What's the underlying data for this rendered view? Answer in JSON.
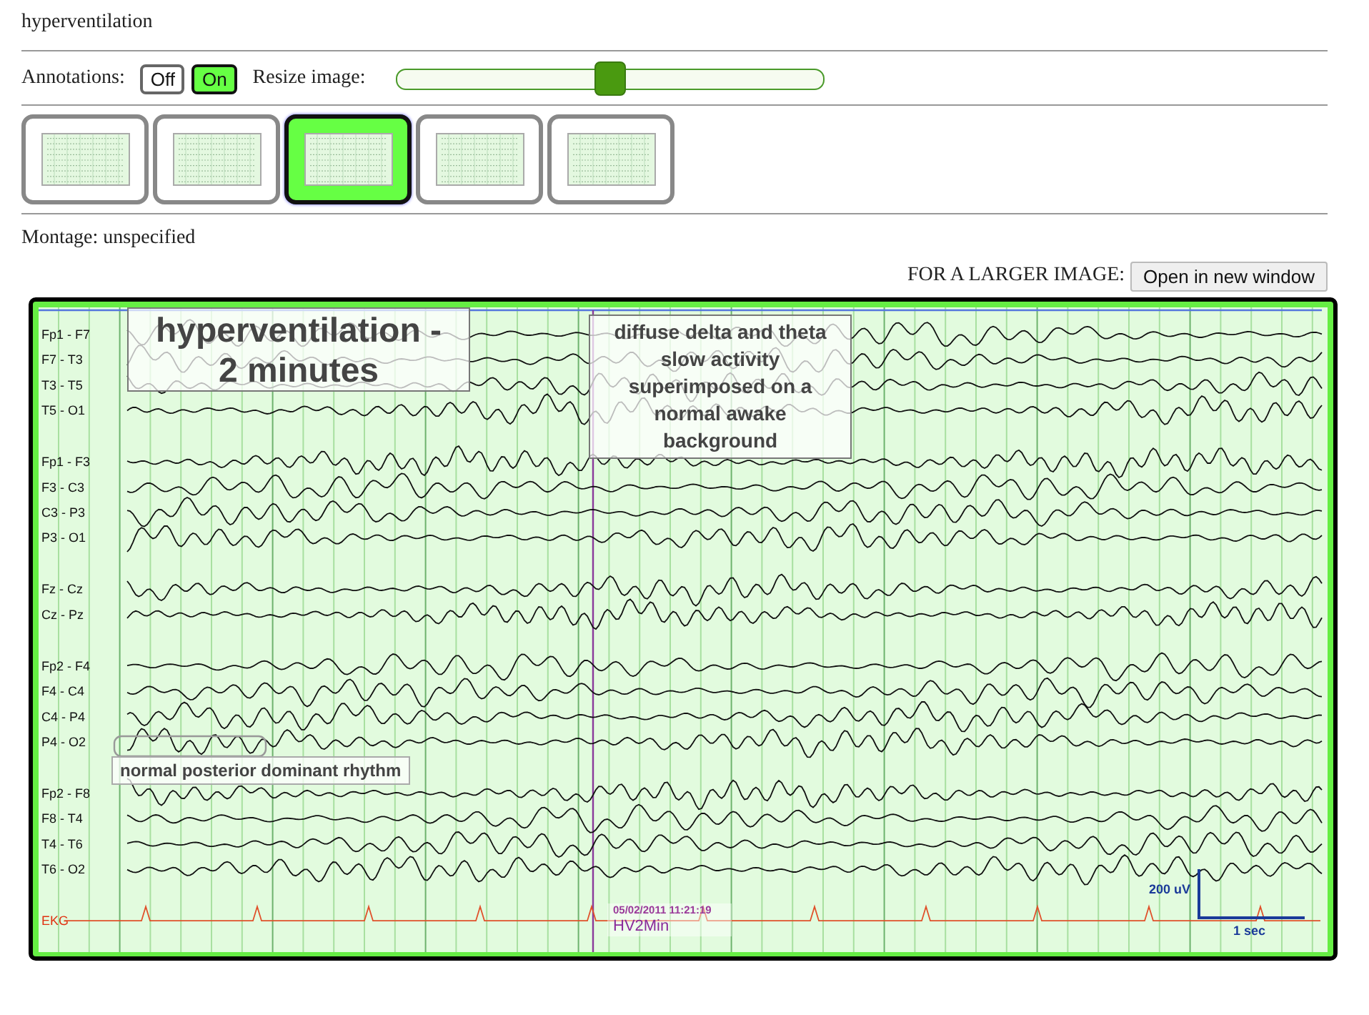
{
  "title": "hyperventilation",
  "annotations_toggle": {
    "label": "Annotations:",
    "options": [
      {
        "label": "Off",
        "selected": false
      },
      {
        "label": "On",
        "selected": true
      }
    ]
  },
  "resize": {
    "label": "Resize image:",
    "level": 0.5
  },
  "thumbnails": [
    {
      "selected": false
    },
    {
      "selected": false
    },
    {
      "selected": true
    },
    {
      "selected": false
    },
    {
      "selected": false
    }
  ],
  "montage": "Montage: unspecified",
  "larger_image": {
    "label": "FOR A LARGER IMAGE:",
    "button": "Open in new window"
  },
  "eeg": {
    "groups": [
      {
        "channels": [
          {
            "label": "Fp1 - F7",
            "kind": "eeg"
          },
          {
            "label": "F7 - T3",
            "kind": "eeg"
          },
          {
            "label": "T3 - T5",
            "kind": "eeg"
          },
          {
            "label": "T5 - O1",
            "kind": "eeg"
          }
        ]
      },
      {
        "channels": [
          {
            "label": "Fp1 - F3",
            "kind": "eeg"
          },
          {
            "label": "F3 - C3",
            "kind": "eeg"
          },
          {
            "label": "C3 - P3",
            "kind": "eeg"
          },
          {
            "label": "P3 - O1",
            "kind": "eeg"
          }
        ]
      },
      {
        "channels": [
          {
            "label": "Fz - Cz",
            "kind": "eeg"
          },
          {
            "label": "Cz - Pz",
            "kind": "eeg"
          }
        ]
      },
      {
        "channels": [
          {
            "label": "Fp2 - F4",
            "kind": "eeg"
          },
          {
            "label": "F4 - C4",
            "kind": "eeg"
          },
          {
            "label": "C4 - P4",
            "kind": "eeg"
          },
          {
            "label": "P4 - O2",
            "kind": "eeg"
          }
        ]
      },
      {
        "channels": [
          {
            "label": "Fp2 - F8",
            "kind": "eeg"
          },
          {
            "label": "F8 - T4",
            "kind": "eeg"
          },
          {
            "label": "T4 - T6",
            "kind": "eeg"
          },
          {
            "label": "T6 - O2",
            "kind": "eeg"
          }
        ]
      },
      {
        "channels": [
          {
            "label": "EKG",
            "kind": "ekg"
          }
        ]
      }
    ],
    "annotations": [
      {
        "kind": "title",
        "text": "hyperventilation - 2 minutes"
      },
      {
        "kind": "note",
        "text": "diffuse delta and theta slow activity superimposed on a normal awake background"
      },
      {
        "kind": "label",
        "text": "normal posterior dominant rhythm"
      }
    ],
    "timestamp": "05/02/2011 11:21:19",
    "event": "HV2Min",
    "scale": {
      "amplitude": "200 uV",
      "time": "1 sec"
    }
  }
}
